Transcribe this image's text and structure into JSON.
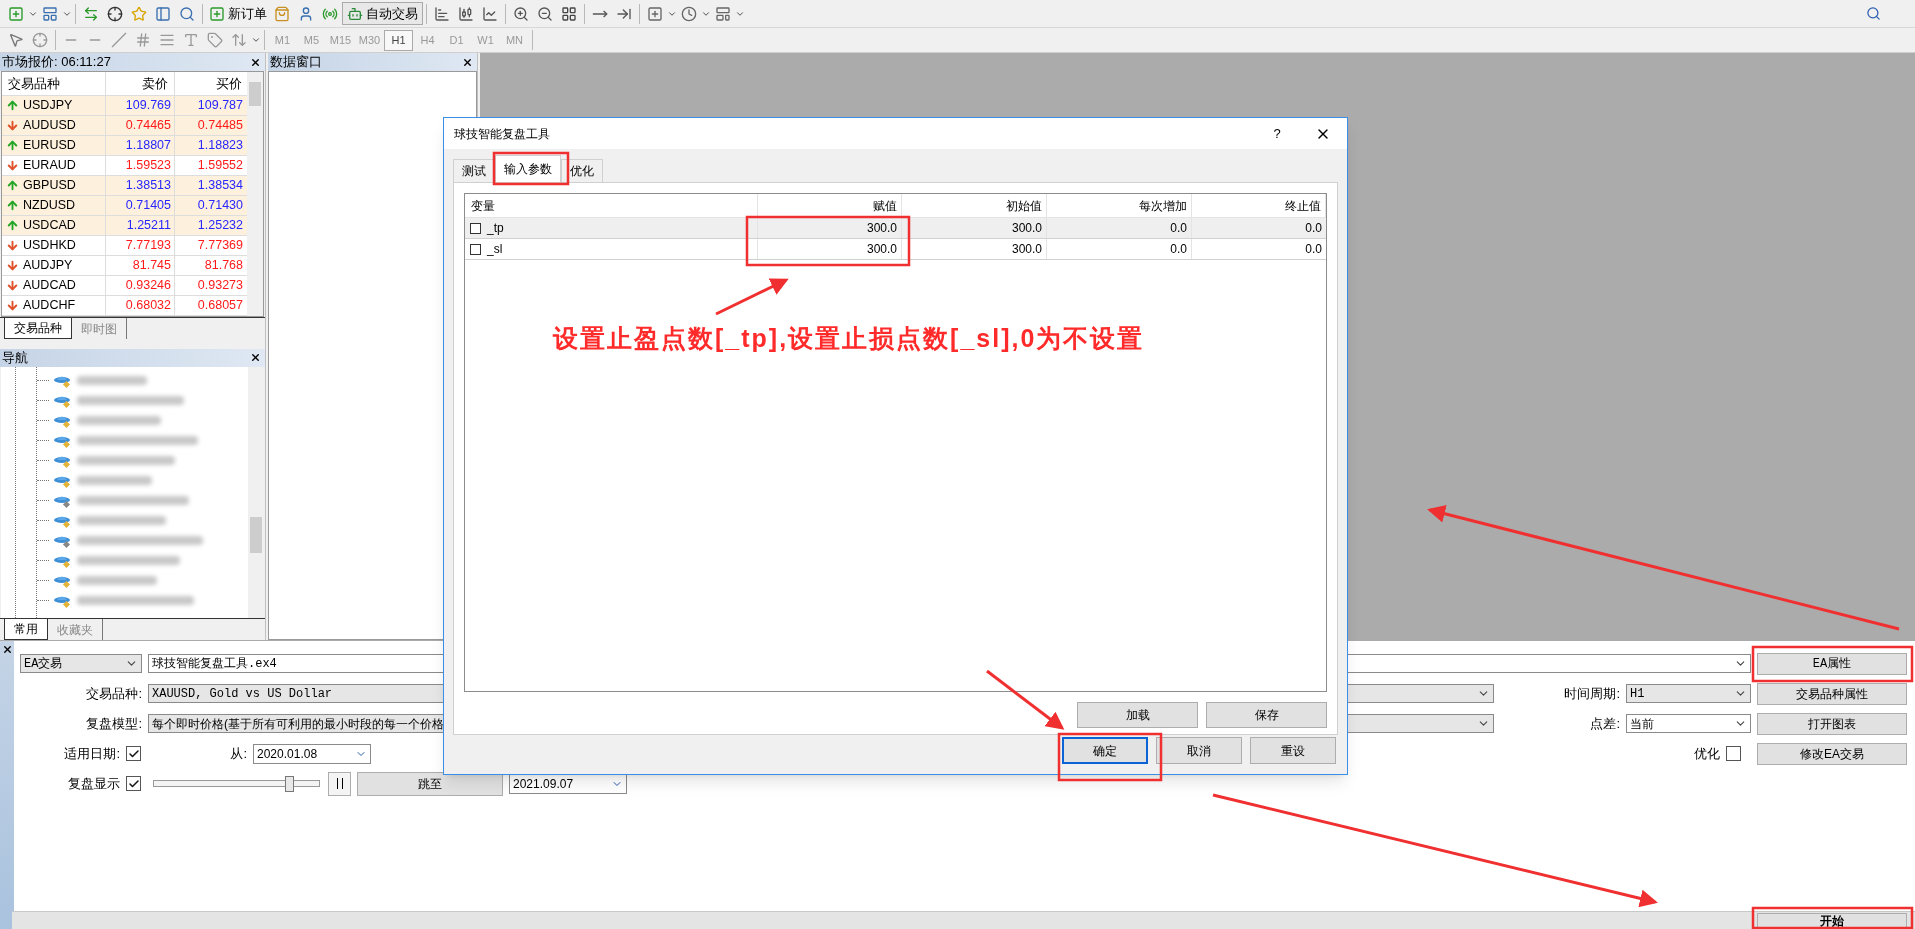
{
  "toolbar": {
    "new_order": "新订单",
    "auto_trading": "自动交易",
    "timeframes": [
      {
        "label": "M1",
        "selected": false
      },
      {
        "label": "M5",
        "selected": false
      },
      {
        "label": "M15",
        "selected": false
      },
      {
        "label": "M30",
        "selected": false
      },
      {
        "label": "H1",
        "selected": true
      },
      {
        "label": "H4",
        "selected": false
      },
      {
        "label": "D1",
        "selected": false
      },
      {
        "label": "W1",
        "selected": false
      },
      {
        "label": "MN",
        "selected": false
      }
    ]
  },
  "market_watch": {
    "title": "市场报价: 06:11:27",
    "columns": [
      "交易品种",
      "卖价",
      "买价"
    ],
    "rows": [
      {
        "symbol": "USDJPY",
        "bid": "109.769",
        "ask": "109.787",
        "kind": "up",
        "highlighted": true
      },
      {
        "symbol": "AUDUSD",
        "bid": "0.74465",
        "ask": "0.74485",
        "kind": "down",
        "highlighted": true
      },
      {
        "symbol": "EURUSD",
        "bid": "1.18807",
        "ask": "1.18823",
        "kind": "up",
        "highlighted": true
      },
      {
        "symbol": "EURAUD",
        "bid": "1.59523",
        "ask": "1.59552",
        "kind": "down",
        "highlighted": false
      },
      {
        "symbol": "GBPUSD",
        "bid": "1.38513",
        "ask": "1.38534",
        "kind": "up",
        "highlighted": true
      },
      {
        "symbol": "NZDUSD",
        "bid": "0.71405",
        "ask": "0.71430",
        "kind": "up",
        "highlighted": true
      },
      {
        "symbol": "USDCAD",
        "bid": "1.25211",
        "ask": "1.25232",
        "kind": "up",
        "highlighted": true
      },
      {
        "symbol": "USDHKD",
        "bid": "7.77193",
        "ask": "7.77369",
        "kind": "down",
        "highlighted": false
      },
      {
        "symbol": "AUDJPY",
        "bid": "81.745",
        "ask": "81.768",
        "kind": "down",
        "highlighted": false
      },
      {
        "symbol": "AUDCAD",
        "bid": "0.93246",
        "ask": "0.93273",
        "kind": "down",
        "highlighted": false
      },
      {
        "symbol": "AUDCHF",
        "bid": "0.68032",
        "ask": "0.68057",
        "kind": "down",
        "highlighted": false
      }
    ],
    "tabs": [
      {
        "label": "交易品种",
        "selected": true
      },
      {
        "label": "即时图",
        "selected": false
      }
    ]
  },
  "data_window": {
    "title": "数据窗口"
  },
  "navigator": {
    "title": "导航",
    "tabs": [
      {
        "label": "常用",
        "selected": true
      },
      {
        "label": "收藏夹",
        "selected": false
      }
    ]
  },
  "tester": {
    "expert_type": "EA交易",
    "expert": "球技智能复盘工具.ex4",
    "symbol_label": "交易品种:",
    "symbol": "XAUUSD, Gold vs US Dollar",
    "model_label": "复盘模型:",
    "model": "每个即时价格(基于所有可利用的最小时段的每一个价格",
    "period_label": "时间周期:",
    "period": "H1",
    "spread_label": "点差:",
    "spread": "当前",
    "use_date_label": "适用日期:",
    "use_date": true,
    "from_label": "从:",
    "from": "2020.01.08",
    "optimization_label": "优化",
    "optimization": false,
    "visual_label": "复盘显示",
    "visual": true,
    "speed": {
      "level": 0.82
    },
    "skip_to": "跳至",
    "to": "2021.09.07",
    "buttons": {
      "expert_properties": "EA属性",
      "symbol_properties": "交易品种属性",
      "open_chart": "打开图表",
      "modify_expert": "修改EA交易",
      "start": "开始"
    }
  },
  "dialog": {
    "title": "球技智能复盘工具",
    "help": "?",
    "tabs": [
      {
        "label": "测试",
        "selected": false
      },
      {
        "label": "输入参数",
        "selected": true
      },
      {
        "label": "优化",
        "selected": false
      }
    ],
    "columns": [
      "变量",
      "赋值",
      "初始值",
      "每次增加",
      "终止值"
    ],
    "rows": [
      {
        "name": "_tp",
        "checked": false,
        "selected": true,
        "value": "300.0",
        "start": "300.0",
        "step": "0.0",
        "stop": "0.0"
      },
      {
        "name": "_sl",
        "checked": false,
        "selected": false,
        "value": "300.0",
        "start": "300.0",
        "step": "0.0",
        "stop": "0.0"
      }
    ],
    "side_buttons": [
      "加载",
      "保存"
    ],
    "footer_buttons": [
      {
        "label": "确定",
        "focused": true
      },
      {
        "label": "取消",
        "focused": false
      },
      {
        "label": "重设",
        "focused": false
      }
    ]
  },
  "annotation": "设置止盈点数[_tp],设置止损点数[_sl],0为不设置"
}
